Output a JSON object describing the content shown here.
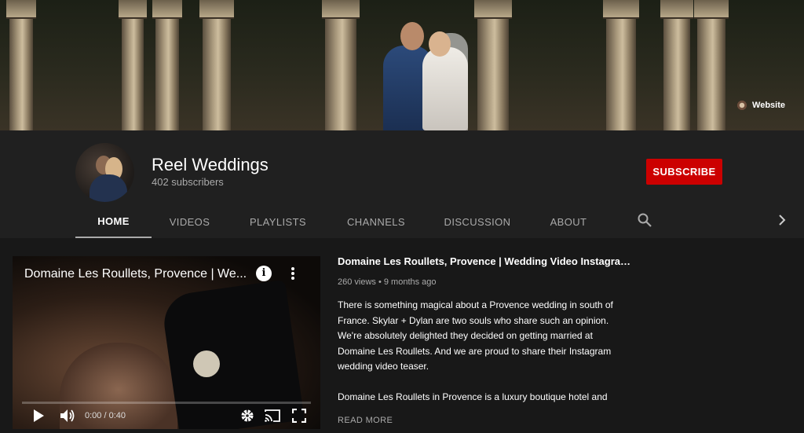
{
  "banner": {
    "website_label": "Website"
  },
  "channel": {
    "name": "Reel Weddings",
    "subscribers": "402 subscribers",
    "subscribe_label": "SUBSCRIBE"
  },
  "tabs": [
    {
      "label": "HOME",
      "active": true
    },
    {
      "label": "VIDEOS"
    },
    {
      "label": "PLAYLISTS"
    },
    {
      "label": "CHANNELS"
    },
    {
      "label": "DISCUSSION"
    },
    {
      "label": "ABOUT"
    }
  ],
  "player": {
    "title": "Domaine Les Roullets, Provence | We...",
    "time": "0:00 / 0:40",
    "progress_fraction": 0.0
  },
  "featured_video": {
    "title": "Domaine Les Roullets, Provence | Wedding Video Instagram T...",
    "meta": "260 views • 9 months ago",
    "description_p1": "There is something magical about a Provence wedding in south of France. Skylar + Dylan are two souls who share such an opinion. We're absolutely delighted they decided on getting married at Domaine Les Roullets. And we are proud to share their Instagram wedding video teaser.",
    "description_p2": "Domaine Les Roullets in Provence is a luxury boutique hotel and",
    "read_more": "READ MORE"
  },
  "colors": {
    "subscribe": "#cc0000",
    "header_bg": "#202020",
    "page_bg": "#181818"
  }
}
